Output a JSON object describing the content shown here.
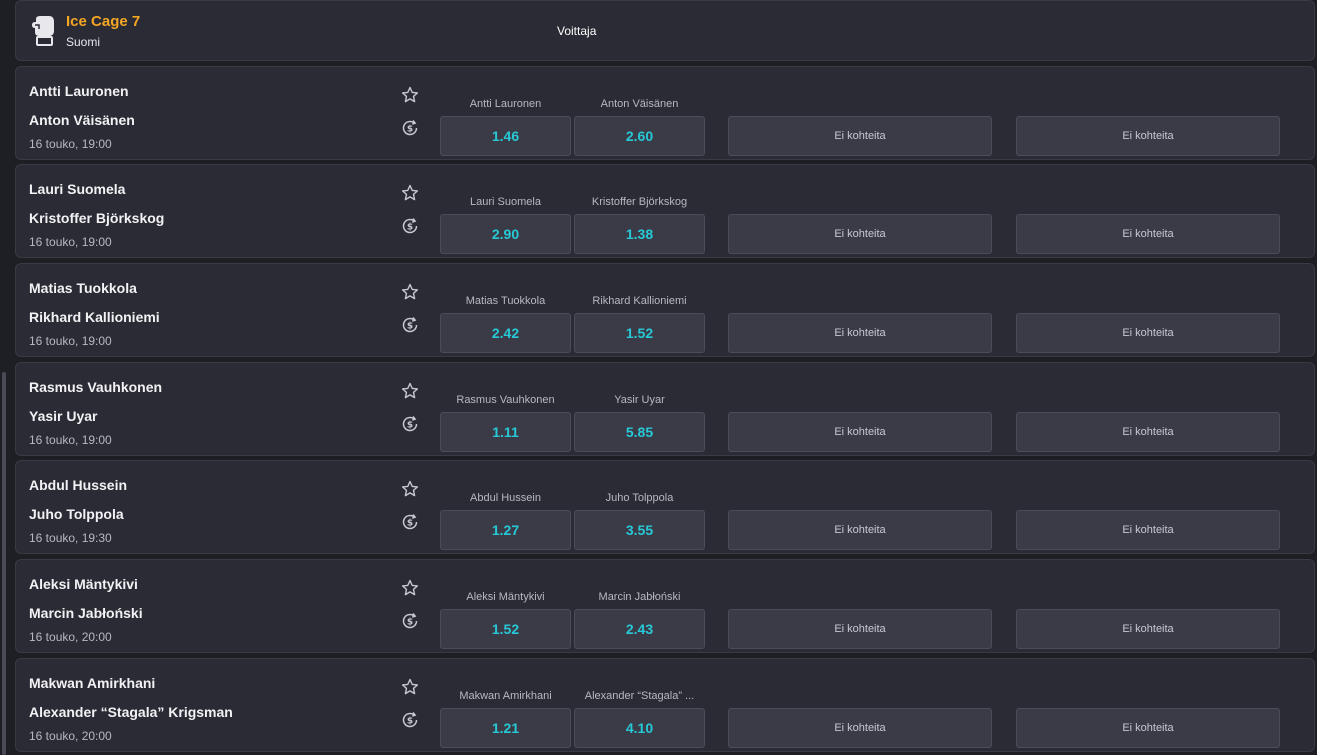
{
  "event": {
    "title": "Ice Cage 7",
    "country": "Suomi",
    "market": "Winner_placeholder"
  },
  "matches": [
    {
      "player1": "Antti Lauronen",
      "player2": "Anton Väisänen",
      "date": "16 touko, 19:00",
      "label1": "Antti Lauronen",
      "label2": "Anton Väisänen",
      "odds1": "1.46",
      "odds2": "2.60",
      "empty1": "Ei kohteita",
      "empty2": "Ei kohteita"
    },
    {
      "player1": "Lauri Suomela",
      "player2": "Kristoffer Björkskog",
      "date": "16 touko, 19:00",
      "label1": "Lauri Suomela",
      "label2": "Kristoffer Björkskog",
      "odds1": "2.90",
      "odds2": "1.38",
      "empty1": "Ei kohteita",
      "empty2": "Ei kohteita"
    },
    {
      "player1": "Matias Tuokkola",
      "player2": "Rikhard Kallioniemi",
      "date": "16 touko, 19:00",
      "label1": "Matias Tuokkola",
      "label2": "Rikhard Kallioniemi",
      "odds1": "2.42",
      "odds2": "1.52",
      "empty1": "Ei kohteita",
      "empty2": "Ei kohteita"
    },
    {
      "player1": "Rasmus Vauhkonen",
      "player2": "Yasir Uyar",
      "date": "16 touko, 19:00",
      "label1": "Rasmus Vauhkonen",
      "label2": "Yasir Uyar",
      "odds1": "1.11",
      "odds2": "5.85",
      "empty1": "Ei kohteita",
      "empty2": "Ei kohteita"
    },
    {
      "player1": "Abdul Hussein",
      "player2": "Juho Tolppola",
      "date": "16 touko, 19:30",
      "label1": "Abdul Hussein",
      "label2": "Juho Tolppola",
      "odds1": "1.27",
      "odds2": "3.55",
      "empty1": "Ei kohteita",
      "empty2": "Ei kohteita"
    },
    {
      "player1": "Aleksi Mäntykivi",
      "player2": "Marcin Jabłoński",
      "date": "16 touko, 20:00",
      "label1": "Aleksi Mäntykivi",
      "label2": "Marcin Jabłoński",
      "odds1": "1.52",
      "odds2": "2.43",
      "empty1": "Ei kohteita",
      "empty2": "Ei kohteita"
    },
    {
      "player1": "Makwan Amirkhani",
      "player2": "Alexander “Stagala” Krigsman",
      "date": "16 touko, 20:00",
      "label1": "Makwan Amirkhani",
      "label2": "Alexander “Stagala” ...",
      "odds1": "1.21",
      "odds2": "4.10",
      "empty1": "Ei kohteita",
      "empty2": "Ei kohteita"
    }
  ],
  "icons": {
    "sport": "boxing-glove-icon",
    "favorite": "star-icon",
    "cashout": "cashout-icon"
  },
  "colors": {
    "accent_title": "#f5a623",
    "odds": "#27c9d6",
    "card": "#2b2b35",
    "button": "#3b3b47",
    "background": "#1e1e25"
  }
}
